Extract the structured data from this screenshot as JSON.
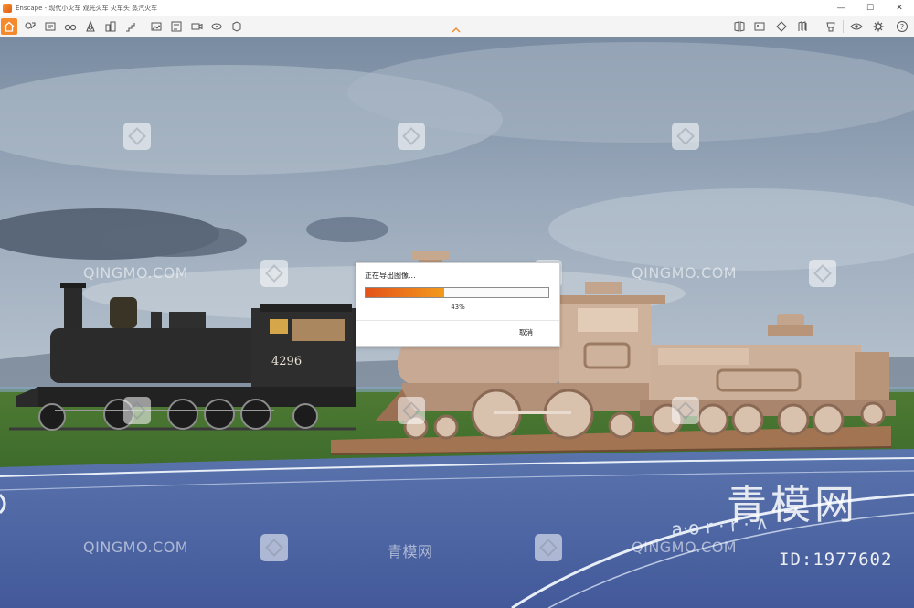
{
  "window": {
    "app_name": "Enscape",
    "separator": " - ",
    "document_title": "现代小火车 观光火车 火车头 蒸汽火车",
    "minimize": "—",
    "maximize": "☐",
    "close": "✕"
  },
  "toolbar": {
    "left_icons": [
      "home-icon",
      "asset-library-icon",
      "camera-settings-icon",
      "binoculars-icon",
      "sun-icon",
      "buildings-icon",
      "stairs-icon",
      "screenshot-icon",
      "batch-render-icon",
      "video-icon",
      "360-panorama-icon",
      "bim-icon"
    ],
    "right_icons": [
      "views-icon",
      "image-icon",
      "material-icon",
      "atlas-icon",
      "visual-settings-icon",
      "eye-icon",
      "gear-icon",
      "help-icon"
    ]
  },
  "scene": {
    "locomotive_number": "4296"
  },
  "watermark": {
    "site": "QINGMO.COM",
    "site_cn": "青模网",
    "big_text": "青模网",
    "id_text": "ID:1977602"
  },
  "export_dialog": {
    "title": "正在导出图像...",
    "progress_value": 0.43,
    "progress_text": "43%",
    "cancel_label": "取消",
    "accent_start": "#e4521a",
    "accent_end": "#f39a1c"
  },
  "colors": {
    "brand_orange": "#f58a2c"
  }
}
